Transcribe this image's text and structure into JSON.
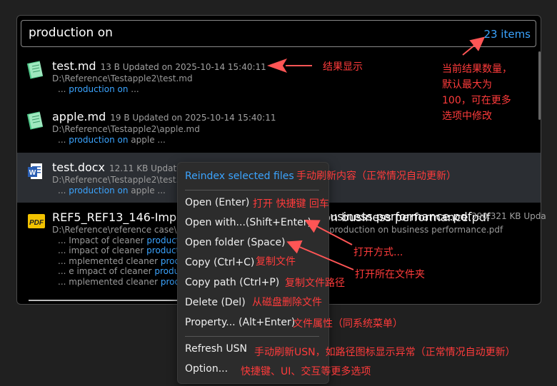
{
  "search": {
    "query": "production on",
    "count": "23 items"
  },
  "results": [
    {
      "name": "test.md",
      "meta": "13 B Updated on 2025-10-14 15:40:11",
      "path": "D:\\Reference\\Testapple2\\test.md",
      "snippet_prefix": "... ",
      "snippet_hl": "production on",
      "snippet_suffix": " ..."
    },
    {
      "name": "apple.md",
      "meta": "19 B Updated on 2025-10-14 15:40:11",
      "path": "D:\\Reference\\Testapple2\\apple.md",
      "snippet_prefix": "... ",
      "snippet_hl": "production on",
      "snippet_suffix": " apple ..."
    },
    {
      "name": "test.docx",
      "meta": "12.11 KB Updated on 2025-10-14 15:40:11",
      "path": "D:\\Reference\\Testapple2\\test.docx",
      "snippet_prefix": "... ",
      "snippet_hl": "production on",
      "snippet_suffix": " apple ..."
    },
    {
      "name": "REF5_REF13_146-Impact of cleaner production on business performance.pdf",
      "name_visible_end": "business performance.pdf",
      "meta": "390.321 KB Upda",
      "path": "D:\\Reference\\reference case\\C",
      "path_end": "production on business performance.pdf",
      "snippets": [
        {
          "prefix": "... Impact of cleaner ",
          "hl": "production"
        },
        {
          "prefix": "... impact of cleaner ",
          "hl": "production"
        },
        {
          "prefix": "... mplemented cleaner ",
          "hl": "produc"
        },
        {
          "prefix": "... e impact of cleaner ",
          "hl": "product"
        },
        {
          "prefix": "... mplemented cleaner ",
          "hl": "produc"
        }
      ]
    }
  ],
  "menu": {
    "reindex": "Reindex selected files",
    "open": "Open (Enter)",
    "open_with": "Open with...(Shift+Enter)",
    "open_folder": "Open folder (Space)",
    "copy": "Copy (Ctrl+C)",
    "copy_path": "Copy path (Ctrl+P)",
    "delete": "Delete (Del)",
    "property": "Property... (Alt+Enter)",
    "refresh_usn": "Refresh USN",
    "option": "Option..."
  },
  "annotations": {
    "results": "结果显示",
    "count_note_lines": [
      "当前结果数量，",
      "默认最大为",
      "100，可在更多",
      "选项中修改"
    ],
    "reindex": "手动刷新内容（正常情况自动更新）",
    "open": "打开 快捷键 回车",
    "open_with": "打开方式...",
    "open_folder": "打开所在文件夹",
    "copy": "复制文件",
    "copy_path": "复制文件路径",
    "delete": "从磁盘删除文件",
    "property": "文件属性（同系统菜单）",
    "refresh_usn": "手动刷新USN，如路径图标显示异常（正常情况自动更新）",
    "option": "快捷键、UI、交互等更多选项"
  },
  "colors": {
    "accent": "#3ba4ff",
    "annotation": "#ff3b3b",
    "selected_row": "#2b2e33"
  },
  "icons": [
    "notepad-icon",
    "notepad-icon",
    "word-icon",
    "pdf-icon"
  ]
}
